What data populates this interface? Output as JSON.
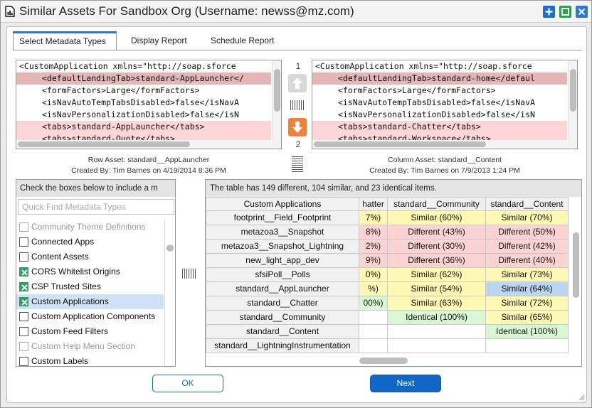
{
  "window": {
    "title": "Similar Assets For Sandbox Org (Username: newss@mz.com)",
    "controls": {
      "add_color": "#1a6fd1",
      "maximize_color": "#2aa34a",
      "close_color": "#2a78d6"
    }
  },
  "tabs": [
    {
      "label": "Select Metadata Types",
      "active": true
    },
    {
      "label": "Display Report",
      "active": false
    },
    {
      "label": "Schedule Report",
      "active": false
    }
  ],
  "left_xml": {
    "lines": [
      {
        "text": "<CustomApplication xmlns=\"http://soap.sforce",
        "indent": 0,
        "highlight": "none"
      },
      {
        "text": "<defaultLandingTab>standard-AppLauncher</",
        "indent": 1,
        "highlight": "dark"
      },
      {
        "text": "<formFactors>Large</formFactors>",
        "indent": 1,
        "highlight": "none"
      },
      {
        "text": "<isNavAutoTempTabsDisabled>false</isNavA",
        "indent": 1,
        "highlight": "none"
      },
      {
        "text": "<isNavPersonalizationDisabled>false</isN",
        "indent": 1,
        "highlight": "none"
      },
      {
        "text": "<tabs>standard-AppLauncher</tabs>",
        "indent": 1,
        "highlight": "light"
      },
      {
        "text": "<tabs>standard-Quote</tabs>",
        "indent": 1,
        "highlight": "light"
      }
    ],
    "asset_label": "Row Asset: standard__AppLauncher",
    "created_by": "Created By: Tim Barnes on 4/19/2014 8:36 PM"
  },
  "right_xml": {
    "lines": [
      {
        "text": "<CustomApplication xmlns=\"http://soap.sforce",
        "indent": 0,
        "highlight": "none"
      },
      {
        "text": "<defaultLandingTab>standard-home</defaul",
        "indent": 1,
        "highlight": "dark"
      },
      {
        "text": "<formFactors>Large</formFactors>",
        "indent": 1,
        "highlight": "none"
      },
      {
        "text": "<isNavAutoTempTabsDisabled>false</isNavA",
        "indent": 1,
        "highlight": "none"
      },
      {
        "text": "<isNavPersonalizationDisabled>false</isN",
        "indent": 1,
        "highlight": "none"
      },
      {
        "text": "<tabs>standard-Chatter</tabs>",
        "indent": 1,
        "highlight": "light"
      },
      {
        "text": "<tabs>standard-Workspace</tabs>",
        "indent": 1,
        "highlight": "light"
      }
    ],
    "asset_label": "Column Asset: standard__Content",
    "created_by": "Created By: Tim Barnes on 7/9/2013 1:24 PM"
  },
  "diff_nav": {
    "current": "1",
    "total": "2",
    "up_icon": "arrow-up-icon",
    "down_icon": "arrow-down-icon",
    "down_color": "#f0803c",
    "up_color": "#d8d8d8"
  },
  "metadata_list": {
    "header": "Check the boxes below to include a m",
    "search_placeholder": "Quick Find Metadata Types",
    "items": [
      {
        "label": "Community Theme Definitions",
        "checked": false,
        "disabled": true,
        "selected": false
      },
      {
        "label": "Connected Apps",
        "checked": false,
        "disabled": false,
        "selected": false
      },
      {
        "label": "Content Assets",
        "checked": false,
        "disabled": false,
        "selected": false
      },
      {
        "label": "CORS Whitelist Origins",
        "checked": true,
        "disabled": false,
        "selected": false
      },
      {
        "label": "CSP Trusted Sites",
        "checked": true,
        "disabled": false,
        "selected": false
      },
      {
        "label": "Custom Applications",
        "checked": true,
        "disabled": false,
        "selected": true
      },
      {
        "label": "Custom Application Components",
        "checked": false,
        "disabled": false,
        "selected": false
      },
      {
        "label": "Custom Feed Filters",
        "checked": false,
        "disabled": false,
        "selected": false
      },
      {
        "label": "Custom Help Menu Section",
        "checked": false,
        "disabled": true,
        "selected": false
      },
      {
        "label": "Custom Labels",
        "checked": false,
        "disabled": false,
        "selected": false
      }
    ]
  },
  "comparison": {
    "summary": "The table has 149 different, 104 similar, and 23 identical items.",
    "corner_header": "Custom Applications",
    "columns": [
      "hatter",
      "standard__Community",
      "standard__Content"
    ],
    "rows": [
      {
        "name": "footprint__Field_Footprint",
        "cells": [
          {
            "text": "7%)",
            "color": "yellow"
          },
          {
            "text": "Similar (60%)",
            "color": "yellow"
          },
          {
            "text": "Similar (70%)",
            "color": "yellow"
          }
        ]
      },
      {
        "name": "metazoa3__Snapshot",
        "cells": [
          {
            "text": "8%)",
            "color": "red"
          },
          {
            "text": "Different (43%)",
            "color": "red"
          },
          {
            "text": "Different (50%)",
            "color": "red"
          }
        ]
      },
      {
        "name": "metazoa3__Snapshot_Lightning",
        "cells": [
          {
            "text": "2%)",
            "color": "red"
          },
          {
            "text": "Different (30%)",
            "color": "red"
          },
          {
            "text": "Different (42%)",
            "color": "red"
          }
        ]
      },
      {
        "name": "new_light_app_dev",
        "cells": [
          {
            "text": "9%)",
            "color": "red"
          },
          {
            "text": "Different (36%)",
            "color": "red"
          },
          {
            "text": "Different (40%)",
            "color": "red"
          }
        ]
      },
      {
        "name": "sfsiPoll__Polls",
        "cells": [
          {
            "text": "0%)",
            "color": "yellow"
          },
          {
            "text": "Similar (62%)",
            "color": "yellow"
          },
          {
            "text": "Similar (73%)",
            "color": "yellow"
          }
        ]
      },
      {
        "name": "standard__AppLauncher",
        "cells": [
          {
            "text": "%)",
            "color": "yellow"
          },
          {
            "text": "Similar (54%)",
            "color": "yellow"
          },
          {
            "text": "Similar (64%)",
            "color": "blue"
          }
        ]
      },
      {
        "name": "standard__Chatter",
        "cells": [
          {
            "text": "00%)",
            "color": "green"
          },
          {
            "text": "Similar (63%)",
            "color": "yellow"
          },
          {
            "text": "Similar (72%)",
            "color": "yellow"
          }
        ]
      },
      {
        "name": "standard__Community",
        "cells": [
          {
            "text": "",
            "color": "white"
          },
          {
            "text": "Identical (100%)",
            "color": "green"
          },
          {
            "text": "Similar (65%)",
            "color": "yellow"
          }
        ]
      },
      {
        "name": "standard__Content",
        "cells": [
          {
            "text": "",
            "color": "white"
          },
          {
            "text": "",
            "color": "white"
          },
          {
            "text": "Identical (100%)",
            "color": "green"
          }
        ]
      },
      {
        "name": "standard__LightningInstrumentation",
        "cells": [
          {
            "text": "",
            "color": "white"
          },
          {
            "text": "",
            "color": "white"
          },
          {
            "text": "",
            "color": "white"
          }
        ]
      }
    ]
  },
  "buttons": {
    "ok": "OK",
    "next": "Next"
  }
}
